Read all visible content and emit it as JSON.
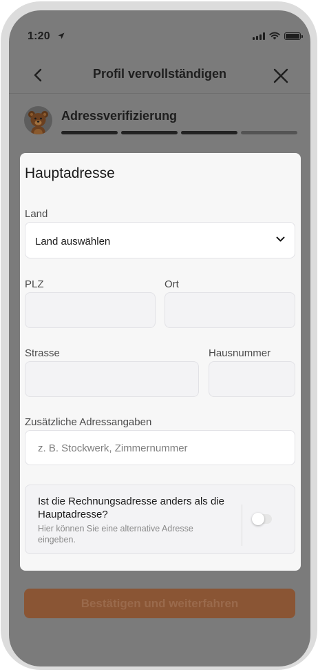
{
  "status_bar": {
    "time": "1:20"
  },
  "header": {
    "title": "Profil vervollständigen"
  },
  "progress": {
    "step_title": "Adressverifizierung",
    "total_steps": 4,
    "completed_steps": 3
  },
  "form": {
    "title": "Hauptadresse",
    "country": {
      "label": "Land",
      "value": "Land auswählen"
    },
    "zip": {
      "label": "PLZ",
      "value": ""
    },
    "city": {
      "label": "Ort",
      "value": ""
    },
    "street": {
      "label": "Strasse",
      "value": ""
    },
    "house_number": {
      "label": "Hausnummer",
      "value": ""
    },
    "additional": {
      "label": "Zusätzliche Adressangaben",
      "placeholder": "z. B. Stockwerk, Zimmernummer"
    },
    "billing_toggle": {
      "question": "Ist die Rechnungsadresse anders als die Hauptadresse?",
      "hint": "Hier können Sie eine alternative Adresse eingeben.",
      "enabled": false
    }
  },
  "actions": {
    "confirm_label": "Bestätigen und weiterfahren"
  },
  "colors": {
    "overlay": "#7b7b7b",
    "accent_dimmed": "#8a5534",
    "card": "#f7f7f7"
  }
}
